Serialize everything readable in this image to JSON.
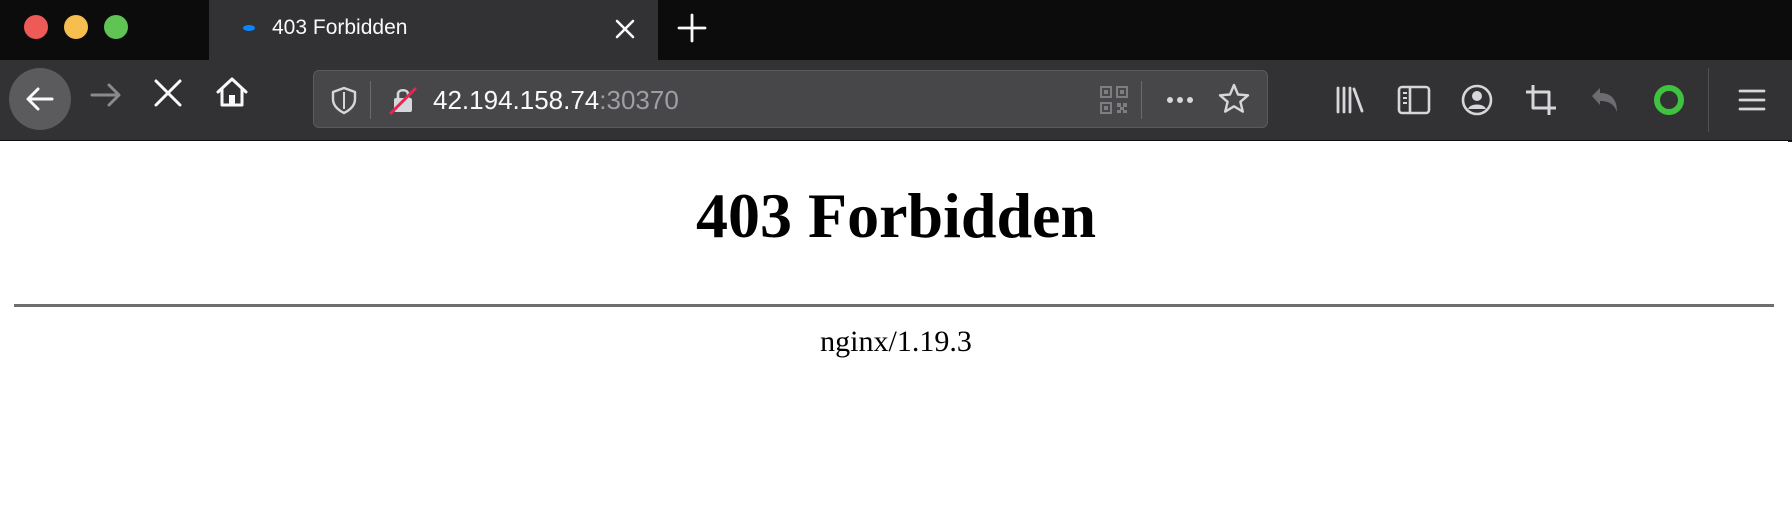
{
  "window": {
    "buttons": [
      "close",
      "minimize",
      "maximize"
    ]
  },
  "tab": {
    "title": "403 Forbidden",
    "favicon": "loading-dot-icon",
    "accent": "#0a84ff"
  },
  "urlbar": {
    "host": "42.194.158.74",
    "port": ":30370"
  },
  "icons": {
    "back": "back-arrow-icon",
    "forward": "forward-arrow-icon",
    "stop": "stop-icon",
    "home": "home-icon",
    "tracking": "shield-icon",
    "insecure": "insecure-lock-icon",
    "qr": "qr-code-icon",
    "page_actions": "more-icon",
    "bookmark": "star-icon",
    "library": "library-icon",
    "sidebar": "sidebar-icon",
    "account": "account-icon",
    "screenshot": "crop-icon",
    "undo": "undo-icon",
    "extension": "extension-ring-icon",
    "menu": "hamburger-menu-icon"
  },
  "colors": {
    "tabstrip": "#0c0c0d",
    "toolbar": "#323234",
    "urlbar": "#474749",
    "extension": "#3fc23f",
    "insecure": "#e22850"
  },
  "page": {
    "heading": "403 Forbidden",
    "signature": "nginx/1.19.3"
  }
}
